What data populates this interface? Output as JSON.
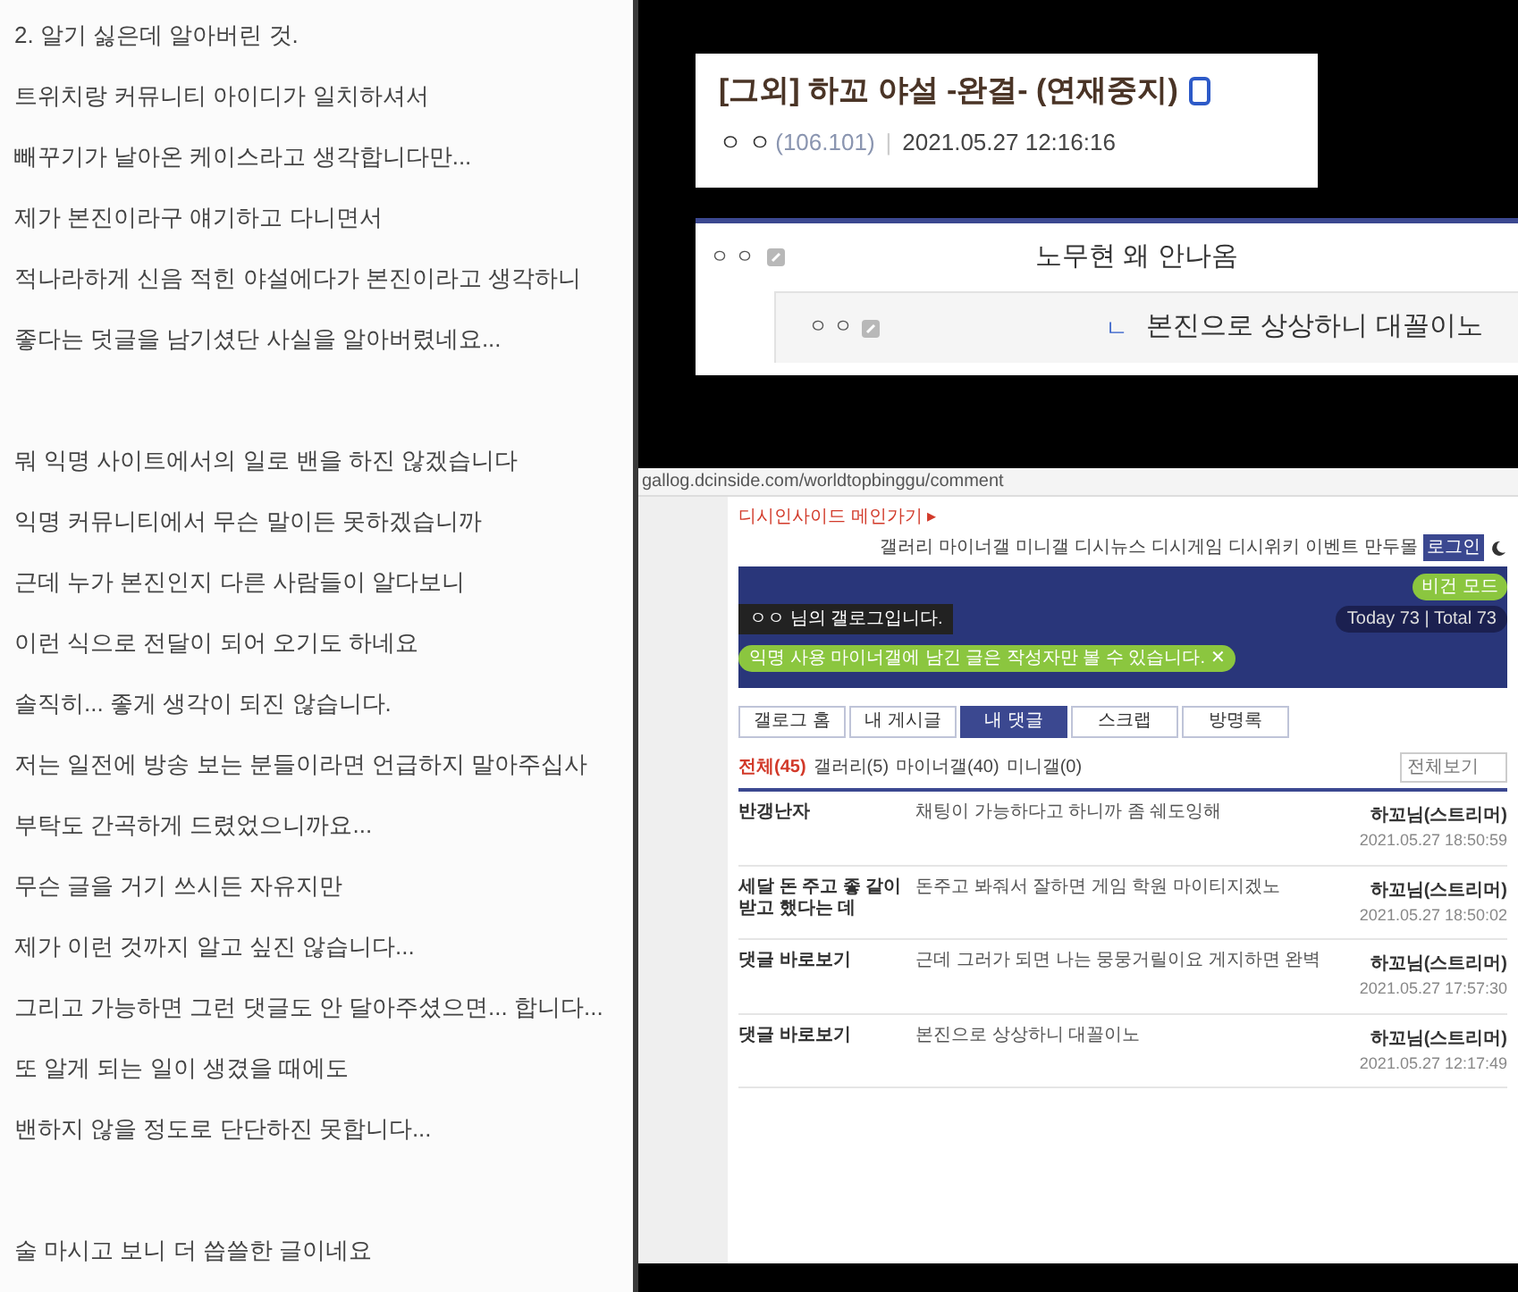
{
  "post_text": {
    "paragraphs": [
      [
        "2. 알기 싫은데 알아버린 것.",
        "트위치랑 커뮤니티 아이디가 일치하셔서",
        "빼꾸기가 날아온 케이스라고 생각합니다만...",
        "제가 본진이라구 얘기하고 다니면서",
        "적나라하게 신음 적힌 야설에다가 본진이라고 생각하니",
        "좋다는 덧글을 남기셨단 사실을 알아버렸네요..."
      ],
      [
        "뭐 익명 사이트에서의 일로 밴을 하진 않겠습니다",
        "익명 커뮤니티에서 무슨 말이든 못하겠습니까",
        "근데 누가 본진인지 다른 사람들이 알다보니",
        "이런 식으로 전달이 되어 오기도 하네요",
        "솔직히... 좋게 생각이 되진 않습니다.",
        "저는 일전에 방송 보는 분들이라면 언급하지 말아주십사",
        "부탁도 간곡하게 드렸었으니까요...",
        "무슨 글을 거기 쓰시든 자유지만",
        "제가 이런 것까지 알고 싶진 않습니다...",
        "그리고 가능하면 그런 댓글도 안 달아주셨으면... 합니다...",
        "또 알게 되는 일이 생겼을 때에도",
        "밴하지 않을 정도로 단단하진 못합니다..."
      ],
      [
        "술 마시고 보니 더 씁쓸한 글이네요"
      ]
    ]
  },
  "post_header": {
    "title": "[그외] 하꼬 야설 -완결- (연재중지)",
    "author": "ㅇ ㅇ",
    "ip": "(106.101)",
    "separator": "|",
    "date": "2021.05.27 12:16:16"
  },
  "comments": [
    {
      "author": "ㅇ ㅇ",
      "text": "노무현 왜 안나옴",
      "replies": [
        {
          "author": "ㅇ ㅇ",
          "marker": "ㄴ",
          "text": "본진으로 상상하니 대꼴이노"
        }
      ]
    }
  ],
  "browser": {
    "url": "gallog.dcinside.com/worldtopbinggu/comment",
    "main_link": "디시인사이드 메인가기 ▸",
    "nav_links": [
      {
        "label": "갤러리",
        "kind": "link"
      },
      {
        "label": "마이너갤",
        "kind": "link"
      },
      {
        "label": "미니갤",
        "kind": "link"
      },
      {
        "label": "디시뉴스",
        "kind": "link"
      },
      {
        "label": "디시게임",
        "kind": "link"
      },
      {
        "label": "디시위키",
        "kind": "link"
      },
      {
        "label": "이벤트",
        "kind": "link"
      },
      {
        "label": "만두몰",
        "kind": "link"
      },
      {
        "label": "로그인",
        "kind": "login"
      }
    ],
    "banner": {
      "greeting": "ㅇㅇ 님의 갤로그입니다.",
      "mode": "비건 모드",
      "visits": "Today 73 | Total 73",
      "notice": "익명 사용 마이너갤에 남긴 글은 작성자만 볼 수 있습니다.",
      "notice_close": "✕"
    },
    "tabs": [
      {
        "label": "갤로그 홈",
        "selected": false
      },
      {
        "label": "내 게시글",
        "selected": false
      },
      {
        "label": "내 댓글",
        "selected": true
      },
      {
        "label": "스크랩",
        "selected": false
      },
      {
        "label": "방명록",
        "selected": false
      }
    ],
    "filters": [
      {
        "label": "전체(45)",
        "selected": true
      },
      {
        "label": "갤러리(5)",
        "selected": false
      },
      {
        "label": "마이너갤(40)",
        "selected": false
      },
      {
        "label": "미니갤(0)",
        "selected": false
      }
    ],
    "view_select": "전체보기",
    "rows": [
      {
        "title": "반갱난자",
        "content": "채팅이 가능하다고 하니까 좀 쉐도잉해",
        "author": "하꼬님(스트리머)",
        "date": "2021.05.27 18:50:59"
      },
      {
        "title": "세달 돈 주고 좋 같이 받고 했다는 데",
        "content": "돈주고 봐줘서 잘하면 게임 학원 마이티지겠노",
        "author": "하꼬님(스트리머)",
        "date": "2021.05.27 18:50:02"
      },
      {
        "title": "댓글 바로보기",
        "content": "근데 그러가 되면 나는 뭉뭉거릴이요 게지하면 완벽",
        "author": "하꼬님(스트리머)",
        "date": "2021.05.27 17:57:30"
      },
      {
        "title": "댓글 바로보기",
        "content": "본진으로 상상하니 대꼴이노",
        "author": "하꼬님(스트리머)",
        "date": "2021.05.27 12:17:49"
      }
    ]
  }
}
